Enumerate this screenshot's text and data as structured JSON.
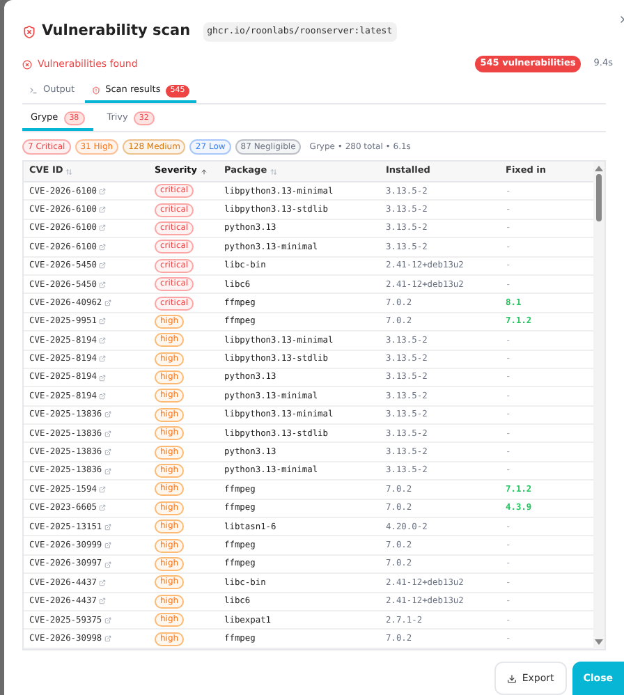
{
  "dialog": {
    "title": "Vulnerability scan",
    "image": "ghcr.io/roonlabs/roonserver:latest"
  },
  "status": {
    "text": "Vulnerabilities found",
    "count": "545 vulnerabilities",
    "duration": "9.4s"
  },
  "tabs": [
    {
      "label": "Output",
      "kind": "terminal",
      "selected": false
    },
    {
      "label": "Scan results",
      "kind": "shield",
      "badge": "545",
      "selected": true
    }
  ],
  "engines": [
    {
      "label": "Grype",
      "count": "38",
      "selected": true
    },
    {
      "label": "Trivy",
      "count": "32",
      "selected": false
    }
  ],
  "filters": [
    {
      "label": "7 Critical",
      "color": "#ef4444"
    },
    {
      "label": "31 High",
      "color": "#f97316"
    },
    {
      "label": "128 Medium",
      "color": "#d97706"
    },
    {
      "label": "27 Low",
      "color": "#3b82f6"
    },
    {
      "label": "87 Negligible",
      "color": "#6b7280"
    }
  ],
  "summary": "Grype • 280 total • 6.1s",
  "table": {
    "columns": [
      {
        "label": "CVE ID",
        "sortable": true,
        "sorted": false
      },
      {
        "label": "Severity",
        "sortable": true,
        "sorted": true
      },
      {
        "label": "Package",
        "sortable": true,
        "sorted": false
      },
      {
        "label": "Installed",
        "sortable": false
      },
      {
        "label": "Fixed in",
        "sortable": false
      }
    ],
    "rows": [
      {
        "cve": "CVE-2026-6100",
        "kind": "critical",
        "severity": "critical",
        "package": "libpython3.13-minimal",
        "installed": "3.13.5-2",
        "fixed_in": "-",
        "has_fix": false
      },
      {
        "cve": "CVE-2026-6100",
        "kind": "critical",
        "severity": "critical",
        "package": "libpython3.13-stdlib",
        "installed": "3.13.5-2",
        "fixed_in": "-",
        "has_fix": false
      },
      {
        "cve": "CVE-2026-6100",
        "kind": "critical",
        "severity": "critical",
        "package": "python3.13",
        "installed": "3.13.5-2",
        "fixed_in": "-",
        "has_fix": false
      },
      {
        "cve": "CVE-2026-6100",
        "kind": "critical",
        "severity": "critical",
        "package": "python3.13-minimal",
        "installed": "3.13.5-2",
        "fixed_in": "-",
        "has_fix": false
      },
      {
        "cve": "CVE-2026-5450",
        "kind": "critical",
        "severity": "critical",
        "package": "libc-bin",
        "installed": "2.41-12+deb13u2",
        "fixed_in": "-",
        "has_fix": false
      },
      {
        "cve": "CVE-2026-5450",
        "kind": "critical",
        "severity": "critical",
        "package": "libc6",
        "installed": "2.41-12+deb13u2",
        "fixed_in": "-",
        "has_fix": false
      },
      {
        "cve": "CVE-2026-40962",
        "kind": "critical",
        "severity": "critical",
        "package": "ffmpeg",
        "installed": "7.0.2",
        "fixed_in": "8.1",
        "has_fix": true
      },
      {
        "cve": "CVE-2025-9951",
        "kind": "high",
        "severity": "high",
        "package": "ffmpeg",
        "installed": "7.0.2",
        "fixed_in": "7.1.2",
        "has_fix": true
      },
      {
        "cve": "CVE-2025-8194",
        "kind": "high",
        "severity": "high",
        "package": "libpython3.13-minimal",
        "installed": "3.13.5-2",
        "fixed_in": "-",
        "has_fix": false
      },
      {
        "cve": "CVE-2025-8194",
        "kind": "high",
        "severity": "high",
        "package": "libpython3.13-stdlib",
        "installed": "3.13.5-2",
        "fixed_in": "-",
        "has_fix": false
      },
      {
        "cve": "CVE-2025-8194",
        "kind": "high",
        "severity": "high",
        "package": "python3.13",
        "installed": "3.13.5-2",
        "fixed_in": "-",
        "has_fix": false
      },
      {
        "cve": "CVE-2025-8194",
        "kind": "high",
        "severity": "high",
        "package": "python3.13-minimal",
        "installed": "3.13.5-2",
        "fixed_in": "-",
        "has_fix": false
      },
      {
        "cve": "CVE-2025-13836",
        "kind": "high",
        "severity": "high",
        "package": "libpython3.13-minimal",
        "installed": "3.13.5-2",
        "fixed_in": "-",
        "has_fix": false
      },
      {
        "cve": "CVE-2025-13836",
        "kind": "high",
        "severity": "high",
        "package": "libpython3.13-stdlib",
        "installed": "3.13.5-2",
        "fixed_in": "-",
        "has_fix": false
      },
      {
        "cve": "CVE-2025-13836",
        "kind": "high",
        "severity": "high",
        "package": "python3.13",
        "installed": "3.13.5-2",
        "fixed_in": "-",
        "has_fix": false
      },
      {
        "cve": "CVE-2025-13836",
        "kind": "high",
        "severity": "high",
        "package": "python3.13-minimal",
        "installed": "3.13.5-2",
        "fixed_in": "-",
        "has_fix": false
      },
      {
        "cve": "CVE-2025-1594",
        "kind": "high",
        "severity": "high",
        "package": "ffmpeg",
        "installed": "7.0.2",
        "fixed_in": "7.1.2",
        "has_fix": true
      },
      {
        "cve": "CVE-2023-6605",
        "kind": "high",
        "severity": "high",
        "package": "ffmpeg",
        "installed": "7.0.2",
        "fixed_in": "4.3.9",
        "has_fix": true
      },
      {
        "cve": "CVE-2025-13151",
        "kind": "high",
        "severity": "high",
        "package": "libtasn1-6",
        "installed": "4.20.0-2",
        "fixed_in": "-",
        "has_fix": false
      },
      {
        "cve": "CVE-2026-30999",
        "kind": "high",
        "severity": "high",
        "package": "ffmpeg",
        "installed": "7.0.2",
        "fixed_in": "-",
        "has_fix": false
      },
      {
        "cve": "CVE-2026-30997",
        "kind": "high",
        "severity": "high",
        "package": "ffmpeg",
        "installed": "7.0.2",
        "fixed_in": "-",
        "has_fix": false
      },
      {
        "cve": "CVE-2026-4437",
        "kind": "high",
        "severity": "high",
        "package": "libc-bin",
        "installed": "2.41-12+deb13u2",
        "fixed_in": "-",
        "has_fix": false
      },
      {
        "cve": "CVE-2026-4437",
        "kind": "high",
        "severity": "high",
        "package": "libc6",
        "installed": "2.41-12+deb13u2",
        "fixed_in": "-",
        "has_fix": false
      },
      {
        "cve": "CVE-2025-59375",
        "kind": "high",
        "severity": "high",
        "package": "libexpat1",
        "installed": "2.7.1-2",
        "fixed_in": "-",
        "has_fix": false
      },
      {
        "cve": "CVE-2026-30998",
        "kind": "high",
        "severity": "high",
        "package": "ffmpeg",
        "installed": "7.0.2",
        "fixed_in": "-",
        "has_fix": false
      }
    ]
  },
  "buttons": [
    {
      "label": "Export",
      "kind": "secondary"
    },
    {
      "label": "Close",
      "kind": "primary"
    }
  ]
}
